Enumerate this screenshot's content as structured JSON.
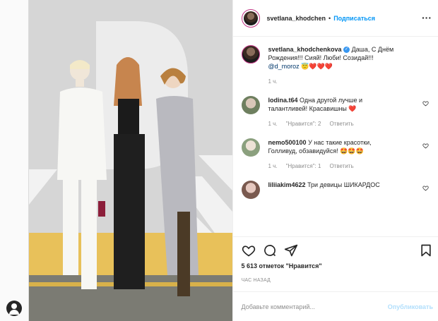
{
  "header": {
    "username": "svetlana_khodchen",
    "separator": "•",
    "follow_label": "Подписаться",
    "more_label": "···"
  },
  "caption": {
    "username": "svetlana_khodchenkova",
    "verified_glyph": "✓",
    "text": "Даша, С Днём Рождения!!! Сияй! Люби! Созидай!!!",
    "mention": "@d_moroz",
    "emoji": "😇❤️❤️❤️",
    "time": "1 ч."
  },
  "comments": [
    {
      "username": "lodina.t64",
      "text": "Одна другой лучше и талантливей! Красавишны",
      "emoji": "❤️",
      "time": "1 ч.",
      "likes": "\"Нравится\": 2",
      "reply": "Ответить"
    },
    {
      "username": "nemo500100",
      "text": "У нас такие красотки, Голливуд, обзавидуйся!",
      "emoji": "🤩🤩🤩",
      "time": "1 ч.",
      "likes": "\"Нравится\": 1",
      "reply": "Ответить"
    },
    {
      "username": "liliiakim4622",
      "text": "Три девицы ШИКАРДОС",
      "emoji": "",
      "time": "",
      "likes": "",
      "reply": ""
    }
  ],
  "actions": {
    "likes_text": "5 613 отметок \"Нравится\"",
    "posted_time": "ЧАС НАЗАД"
  },
  "add_comment": {
    "placeholder": "Добавьте комментарий...",
    "publish_label": "Опубликовать"
  },
  "colors": {
    "accent": "#0095f6",
    "heart": "#ed4956",
    "border": "#dbdbdb",
    "muted": "#8e8e8e"
  },
  "icons": [
    "more-icon",
    "verified-icon",
    "heart-icon",
    "comment-icon",
    "share-icon",
    "bookmark-icon",
    "profile-icon"
  ]
}
